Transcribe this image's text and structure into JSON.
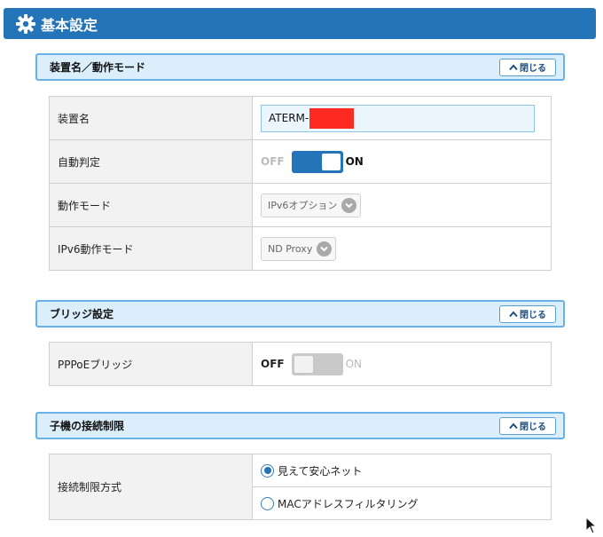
{
  "header": {
    "title": "基本設定",
    "icon": "gear-icon",
    "color": "#2474b9"
  },
  "close_label": "閉じる",
  "section_device": {
    "title": "装置名／動作モード",
    "rows": {
      "device_name": {
        "label": "装置名",
        "value": "ATERM-"
      },
      "auto_detect": {
        "label": "自動判定",
        "off": "OFF",
        "on": "ON",
        "state": "on"
      },
      "mode": {
        "label": "動作モード",
        "selected": "IPv6オプション"
      },
      "ipv6_mode": {
        "label": "IPv6動作モード",
        "selected": "ND Proxy"
      }
    }
  },
  "section_bridge": {
    "title": "ブリッジ設定",
    "rows": {
      "pppoe": {
        "label": "PPPoEブリッジ",
        "off": "OFF",
        "on": "ON",
        "state": "off"
      }
    }
  },
  "section_child": {
    "title": "子機の接続制限",
    "rows": {
      "method": {
        "label": "接続制限方式",
        "options": [
          {
            "label": "見えて安心ネット",
            "checked": true
          },
          {
            "label": "MACアドレスフィルタリング",
            "checked": false
          }
        ]
      }
    }
  }
}
